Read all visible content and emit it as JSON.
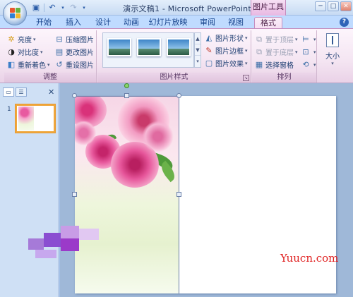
{
  "window": {
    "title": "演示文稿1 - Microsoft PowerPoint",
    "context_tab_title": "图片工具",
    "controls": [
      "─",
      "□",
      "✕"
    ]
  },
  "qat": {
    "save": "save-icon",
    "undo": "undo-icon",
    "redo": "redo-icon"
  },
  "tabs": [
    {
      "label": "开始"
    },
    {
      "label": "插入"
    },
    {
      "label": "设计"
    },
    {
      "label": "动画"
    },
    {
      "label": "幻灯片放映"
    },
    {
      "label": "审阅"
    },
    {
      "label": "视图"
    },
    {
      "label": "格式",
      "active": true
    }
  ],
  "ribbon": {
    "adjust": {
      "label": "调整",
      "brightness": "亮度",
      "contrast": "对比度",
      "recolor": "重新着色",
      "compress": "压缩图片",
      "change": "更改图片",
      "reset": "重设图片"
    },
    "picture_styles": {
      "label": "图片样式",
      "shape": "图片形状",
      "border": "图片边框",
      "effects": "图片效果"
    },
    "arrange": {
      "label": "排列",
      "bring_front": "置于顶层",
      "send_back": "置于底层",
      "selection_pane": "选择窗格"
    },
    "size": {
      "label": "大小"
    }
  },
  "slides_panel": {
    "slide_number": "1"
  },
  "watermark": "Yuucn.com",
  "colors": {
    "context_tab": "#e8b8e2",
    "ribbon_bg": "#f4e5f2",
    "selection_thumb_border": "#f0a73c",
    "watermark": "#e02020"
  }
}
